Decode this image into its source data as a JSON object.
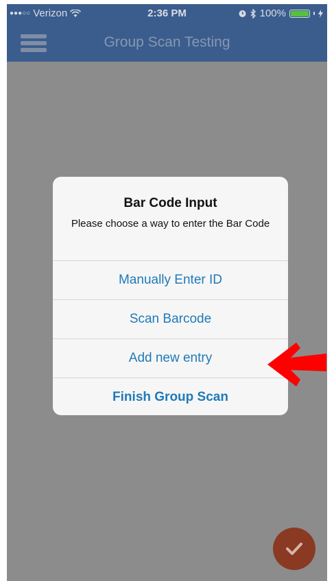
{
  "status_bar": {
    "carrier": "Verizon",
    "time": "2:36 PM",
    "battery": "100%",
    "signal_icon": "signal-dots-icon",
    "wifi_icon": "wifi-icon",
    "bluetooth_icon": "bluetooth-icon",
    "alarm_icon": "alarm-icon",
    "charging_icon": "charging-bolt-icon"
  },
  "navbar": {
    "title": "Group Scan Testing",
    "menu_icon": "hamburger-menu-icon"
  },
  "dialog": {
    "title": "Bar Code Input",
    "message": "Please choose a way to enter the Bar Code",
    "options": [
      {
        "label": "Manually Enter ID"
      },
      {
        "label": "Scan Barcode"
      },
      {
        "label": "Add new entry"
      },
      {
        "label": "Finish Group Scan"
      }
    ]
  },
  "annotation": {
    "icon": "red-arrow-icon",
    "color": "#ff0000"
  },
  "fab": {
    "icon": "checkmark-icon"
  },
  "colors": {
    "navbar": "#3b5d8d",
    "dim_overlay": "#8c8c8c",
    "dialog_link": "#1f7ab8",
    "fab": "#8a3a22",
    "battery_fill": "#55c13c"
  }
}
